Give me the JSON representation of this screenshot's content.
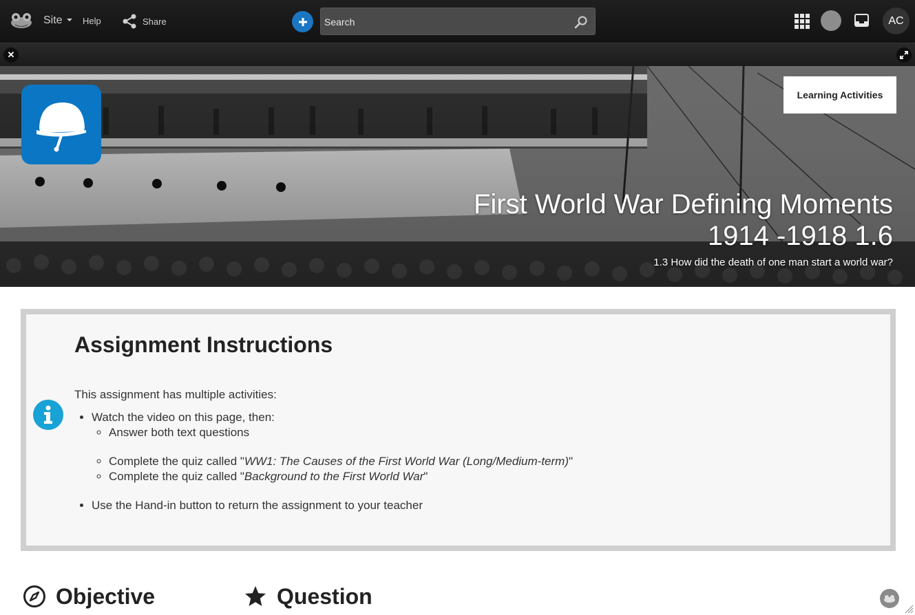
{
  "nav": {
    "site_label": "Site",
    "help_label": "Help",
    "share_label": "Share",
    "search_placeholder": "Search",
    "avatar_initials": "AC"
  },
  "banner": {
    "learning_activities_label": "Learning Activities",
    "title_line1": "First World War Defining Moments",
    "title_line2": "1914 -1918 1.6",
    "subtitle": "1.3 How did the death of one man start a world war?"
  },
  "instructions": {
    "heading": "Assignment Instructions",
    "lead": "This assignment has multiple activities:",
    "item_video": "Watch the video on this page, then:",
    "sub_answer": "Answer both text questions",
    "sub_quiz1_prefix": "Complete the quiz called \"",
    "sub_quiz1_title": "WW1: The Causes of the First World War (Long/Medium-term)",
    "sub_quiz1_suffix": "\"",
    "sub_quiz2_prefix": "Complete the quiz called \"",
    "sub_quiz2_title": "Background to the First World War",
    "sub_quiz2_suffix": "\"",
    "item_handin": "Use the Hand-in button to return the assignment to your teacher"
  },
  "sections": {
    "objective": "Objective",
    "question": "Question"
  },
  "colors": {
    "accent_blue": "#1a76c2",
    "tile_blue": "#0a76c4",
    "info_blue": "#18a2d6"
  }
}
